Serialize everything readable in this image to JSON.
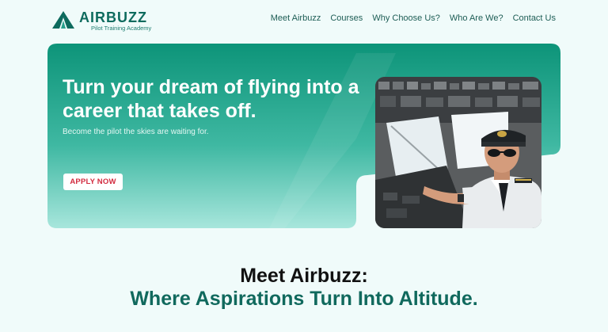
{
  "header": {
    "logo_name": "AIRBUZZ",
    "logo_tagline": "Pilot Training Academy",
    "nav": [
      "Meet Airbuzz",
      "Courses",
      "Why Choose Us?",
      "Who Are We?",
      "Contact Us"
    ]
  },
  "hero": {
    "title": "Turn your dream of flying into a career that takes off.",
    "subtitle": "Become the pilot the skies are waiting for.",
    "cta_label": "APPLY NOW",
    "image_icon": "pilot-in-cockpit-photo"
  },
  "section": {
    "title": "Meet Airbuzz:",
    "subtitle": "Where Aspirations Turn Into Altitude."
  },
  "colors": {
    "brand": "#0e6b5e",
    "page_bg": "#f0fbfa",
    "cta_text": "#d22b3f"
  }
}
